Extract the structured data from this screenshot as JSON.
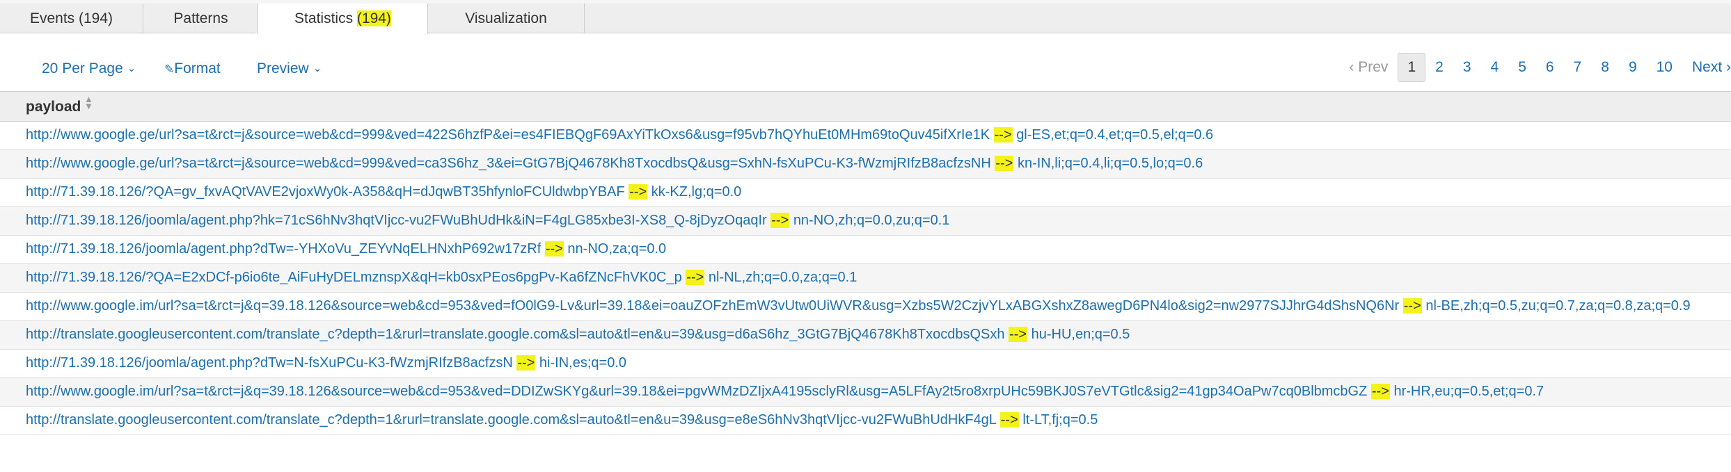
{
  "tabs": [
    {
      "label": "Events (194)"
    },
    {
      "label": "Patterns"
    },
    {
      "label_main": "Statistics ",
      "label_count": "(194)"
    },
    {
      "label": "Visualization"
    }
  ],
  "controls": {
    "per_page": "20 Per Page",
    "format": "Format",
    "preview": "Preview"
  },
  "pager": {
    "prev": "‹ Prev",
    "pages": [
      "1",
      "2",
      "3",
      "4",
      "5",
      "6",
      "7",
      "8",
      "9",
      "10"
    ],
    "current": "1",
    "next": "Next ›"
  },
  "table": {
    "column": "payload",
    "arrow": "-->",
    "rows": [
      {
        "url": "http://www.google.ge/url?sa=t&rct=j&source=web&cd=999&ved=422S6hzfP&ei=es4FIEBQgF69AxYiTkOxs6&usg=f95vb7hQYhuEt0MHm69toQuv45ifXrIe1K",
        "tail": "gl-ES,et;q=0.4,et;q=0.5,el;q=0.6"
      },
      {
        "url": "http://www.google.ge/url?sa=t&rct=j&source=web&cd=999&ved=ca3S6hz_3&ei=GtG7BjQ4678Kh8TxocdbsQ&usg=SxhN-fsXuPCu-K3-fWzmjRIfzB8acfzsNH",
        "tail": "kn-IN,li;q=0.4,li;q=0.5,lo;q=0.6"
      },
      {
        "url": "http://71.39.18.126/?QA=gv_fxvAQtVAVE2vjoxWy0k-A358&qH=dJqwBT35hfynloFCUldwbpYBAF",
        "tail": "kk-KZ,lg;q=0.0"
      },
      {
        "url": "http://71.39.18.126/joomla/agent.php?hk=71cS6hNv3hqtVIjcc-vu2FWuBhUdHk&iN=F4gLG85xbe3I-XS8_Q-8jDyzOqaqIr",
        "tail": "nn-NO,zh;q=0.0,zu;q=0.1"
      },
      {
        "url": "http://71.39.18.126/joomla/agent.php?dTw=-YHXoVu_ZEYvNqELHNxhP692w17zRf",
        "tail": "nn-NO,za;q=0.0"
      },
      {
        "url": "http://71.39.18.126/?QA=E2xDCf-p6io6te_AiFuHyDELmznspX&qH=kb0sxPEos6pgPv-Ka6fZNcFhVK0C_p",
        "tail": "nl-NL,zh;q=0.0,za;q=0.1"
      },
      {
        "url": "http://www.google.im/url?sa=t&rct=j&q=39.18.126&source=web&cd=953&ved=fO0lG9-Lv&url=39.18&ei=oauZOFzhEmW3vUtw0UiWVR&usg=Xzbs5W2CzjvYLxABGXshxZ8awegD6PN4lo&sig2=nw2977SJJhrG4dShsNQ6Nr",
        "tail": "nl-BE,zh;q=0.5,zu;q=0.7,za;q=0.8,za;q=0.9"
      },
      {
        "url": "http://translate.googleusercontent.com/translate_c?depth=1&rurl=translate.google.com&sl=auto&tl=en&u=39&usg=d6aS6hz_3GtG7BjQ4678Kh8TxocdbsQSxh",
        "tail": "hu-HU,en;q=0.5"
      },
      {
        "url": "http://71.39.18.126/joomla/agent.php?dTw=N-fsXuPCu-K3-fWzmjRIfzB8acfzsN",
        "tail": "hi-IN,es;q=0.0"
      },
      {
        "url": "http://www.google.im/url?sa=t&rct=j&q=39.18.126&source=web&cd=953&ved=DDIZwSKYg&url=39.18&ei=pgvWMzDZIjxA4195sclyRl&usg=A5LFfAy2t5ro8xrpUHc59BKJ0S7eVTGtlc&sig2=41gp34OaPw7cq0BlbmcbGZ",
        "tail": "hr-HR,eu;q=0.5,et;q=0.7"
      },
      {
        "url": "http://translate.googleusercontent.com/translate_c?depth=1&rurl=translate.google.com&sl=auto&tl=en&u=39&usg=e8eS6hNv3hqtVIjcc-vu2FWuBhUdHkF4gL",
        "tail": "lt-LT,fj;q=0.5"
      }
    ]
  }
}
